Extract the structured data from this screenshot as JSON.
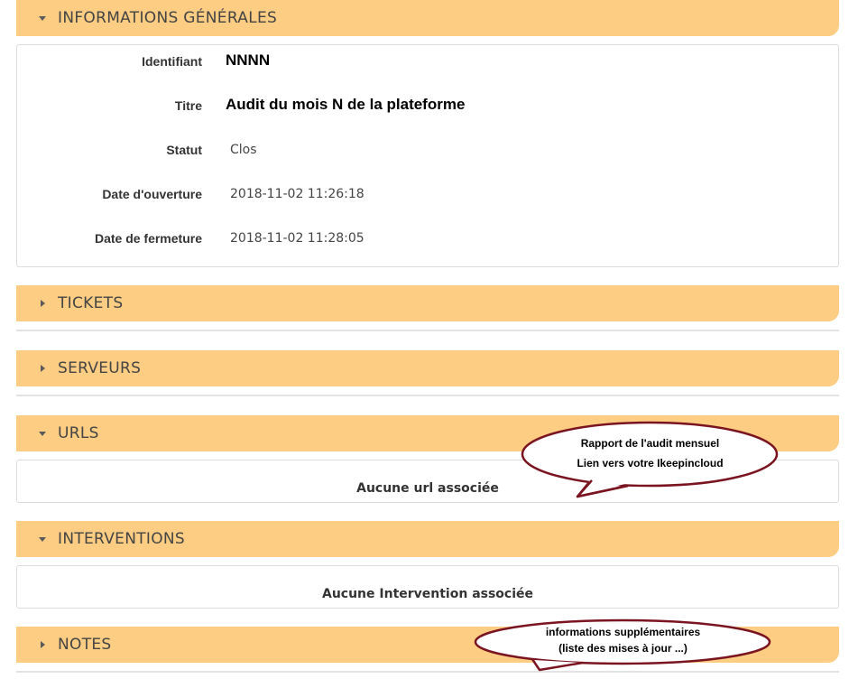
{
  "sections": {
    "general": {
      "title": "INFORMATIONS GÉNÉRALES"
    },
    "tickets": {
      "title": "TICKETS"
    },
    "servers": {
      "title": "SERVEURS"
    },
    "urls": {
      "title": "URLS",
      "empty": "Aucune url associée"
    },
    "interventions": {
      "title": "INTERVENTIONS",
      "empty": "Aucune Intervention associée"
    },
    "notes": {
      "title": "NOTES"
    }
  },
  "info": {
    "id_label": "Identifiant",
    "id_value": "NNNN",
    "title_label": "Titre",
    "title_value": "Audit du mois N de la plateforme",
    "status_label": "Statut",
    "status_value": "Clos",
    "opened_label": "Date d'ouverture",
    "opened_value": "2018-11-02 11:26:18",
    "closed_label": "Date de fermeture",
    "closed_value": "2018-11-02 11:28:05"
  },
  "callouts": {
    "report": {
      "line1": "Rapport de l'audit mensuel",
      "line2": "Lien vers votre Ikeepincloud"
    },
    "notes": {
      "line1": "informations supplémentaires",
      "line2": "(liste des mises à jour ...)"
    }
  },
  "colors": {
    "header_bg": "#fdcd83",
    "callout_border": "#7a1420"
  }
}
